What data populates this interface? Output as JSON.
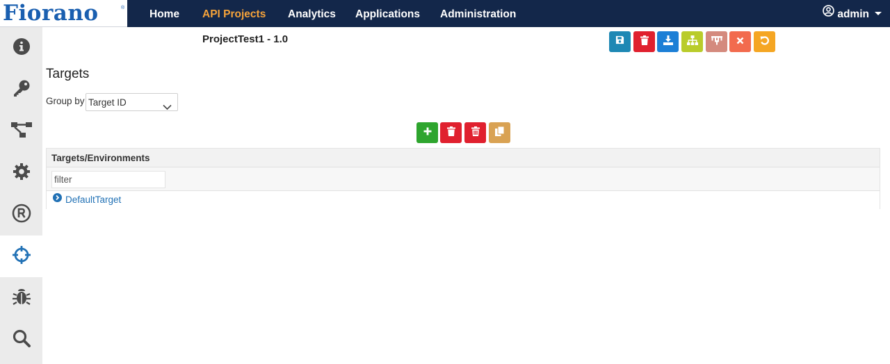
{
  "app": {
    "logo_text": "Fiorano",
    "logo_mark": "®"
  },
  "nav": {
    "items": [
      {
        "label": "Home",
        "active": false
      },
      {
        "label": "API Projects",
        "active": true
      },
      {
        "label": "Analytics",
        "active": false
      },
      {
        "label": "Applications",
        "active": false
      },
      {
        "label": "Administration",
        "active": false
      }
    ],
    "user": "admin"
  },
  "sidebar": {
    "items": [
      {
        "icon": "info-icon",
        "active": false
      },
      {
        "icon": "key-icon",
        "active": false
      },
      {
        "icon": "flow-icon",
        "active": false
      },
      {
        "icon": "gear-icon",
        "active": false
      },
      {
        "icon": "registered-icon",
        "active": false
      },
      {
        "icon": "crosshairs-icon",
        "active": true
      },
      {
        "icon": "bug-icon",
        "active": false
      },
      {
        "icon": "search-icon",
        "active": false
      }
    ]
  },
  "project": {
    "title": "ProjectTest1 - 1.0"
  },
  "toolbar": {
    "buttons": [
      {
        "icon": "save-icon",
        "color": "#1e88b4"
      },
      {
        "icon": "trash-icon",
        "color": "#e0202e"
      },
      {
        "icon": "download-icon",
        "color": "#1c7fd6"
      },
      {
        "icon": "sitemap-icon",
        "color": "#b9cc2b"
      },
      {
        "icon": "hierarchy-icon",
        "color": "#d48a7e"
      },
      {
        "icon": "close-icon",
        "color": "#f26b4e"
      },
      {
        "icon": "undo-icon",
        "color": "#f5a623"
      }
    ]
  },
  "targets": {
    "title": "Targets",
    "group_by_label": "Group by",
    "group_by_value": "Target ID",
    "actions": [
      {
        "icon": "plus-icon",
        "color": "#2ea52e"
      },
      {
        "icon": "trash-icon",
        "color": "#e0202e"
      },
      {
        "icon": "trash-icon",
        "color": "#e0202e"
      },
      {
        "icon": "copy-icon",
        "color": "#d9a253"
      }
    ],
    "table": {
      "header": "Targets/Environments",
      "filter_placeholder": "filter",
      "rows": [
        {
          "label": "DefaultTarget"
        }
      ]
    }
  }
}
